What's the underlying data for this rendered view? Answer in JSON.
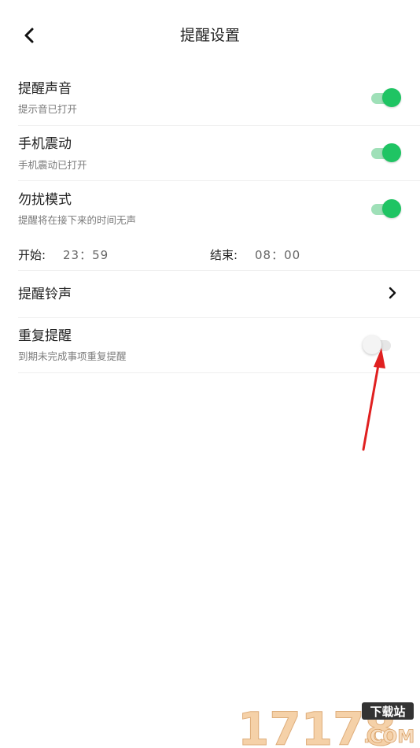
{
  "header": {
    "title": "提醒设置",
    "back_icon": "back-chevron-icon"
  },
  "settings": {
    "sound": {
      "title": "提醒声音",
      "subtitle": "提示音已打开",
      "enabled": true
    },
    "vibrate": {
      "title": "手机震动",
      "subtitle": "手机震动已打开",
      "enabled": true
    },
    "dnd": {
      "title": "勿扰模式",
      "subtitle": "提醒将在接下来的时间无声",
      "enabled": true,
      "start_label": "开始:",
      "start_time": "23：59",
      "end_label": "结束:",
      "end_time": "08：00"
    },
    "ringtone": {
      "title": "提醒铃声"
    },
    "repeat": {
      "title": "重复提醒",
      "subtitle": "到期未完成事项重复提醒",
      "enabled": false
    }
  },
  "colors": {
    "accent": "#1fc463",
    "annotation_arrow": "#e02020"
  },
  "watermark": {
    "text": "17178",
    "badge": "下载站",
    "suffix": ".COM"
  }
}
